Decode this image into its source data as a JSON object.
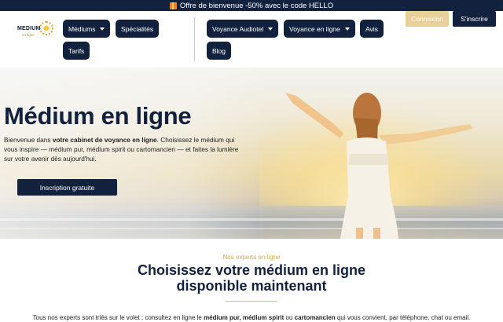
{
  "promo": {
    "text": "Offre de bienvenue -50% avec le code HELLO",
    "icon": "gift-icon"
  },
  "logo": {
    "word": "MEDIUM",
    "sub": "en ligne"
  },
  "nav": {
    "mediums": "Médiums",
    "specialites": "Spécialités",
    "tarifs": "Tarifs",
    "voyance_audiotel": "Voyance Audiotel",
    "voyance_en_ligne": "Voyance en ligne",
    "avis": "Avis",
    "blog": "Blog"
  },
  "auth": {
    "login": "Connexion",
    "signup": "S'inscrire"
  },
  "hero": {
    "title": "Médium en ligne",
    "lead_1": "Bienvenue dans ",
    "lead_bold": "votre cabinet de voyance en ligne",
    "lead_2": ". Choisissez le médium qui vous inspire — médium pur, médium spirit ou cartomancien — et faites la lumière sur votre avenir dès aujourd'hui.",
    "cta": "Inscription gratuite"
  },
  "experts": {
    "eyebrow": "Nos experts en ligne",
    "title_line1": "Choisissez votre médium en ligne",
    "title_line2": "disponible maintenant",
    "desc_1": "Tous nos experts sont triés sur le volet ; consultez en ligne le ",
    "desc_b1": "médium pur, médium spirit",
    "desc_2": " ou ",
    "desc_b2": "cartomancien",
    "desc_3": " qui vous convient, par téléphone, chat ou email."
  },
  "colors": {
    "navy": "#12213d",
    "gold": "#e9cf98",
    "accent": "#d3a95b"
  }
}
